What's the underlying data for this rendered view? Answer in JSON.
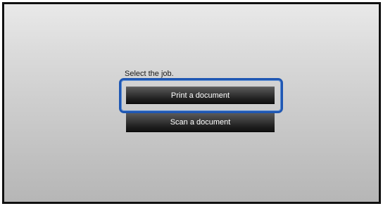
{
  "screen": {
    "prompt": "Select the job.",
    "jobs": [
      {
        "label": "Print a document",
        "selected": true
      },
      {
        "label": "Scan a document",
        "selected": false
      }
    ]
  },
  "colors": {
    "focus_ring": "#1f57b3",
    "button_dark": "#1e1e1e",
    "button_text": "#ffffff",
    "screen_top": "#e9e9e9",
    "screen_bottom": "#b6b6b6"
  }
}
